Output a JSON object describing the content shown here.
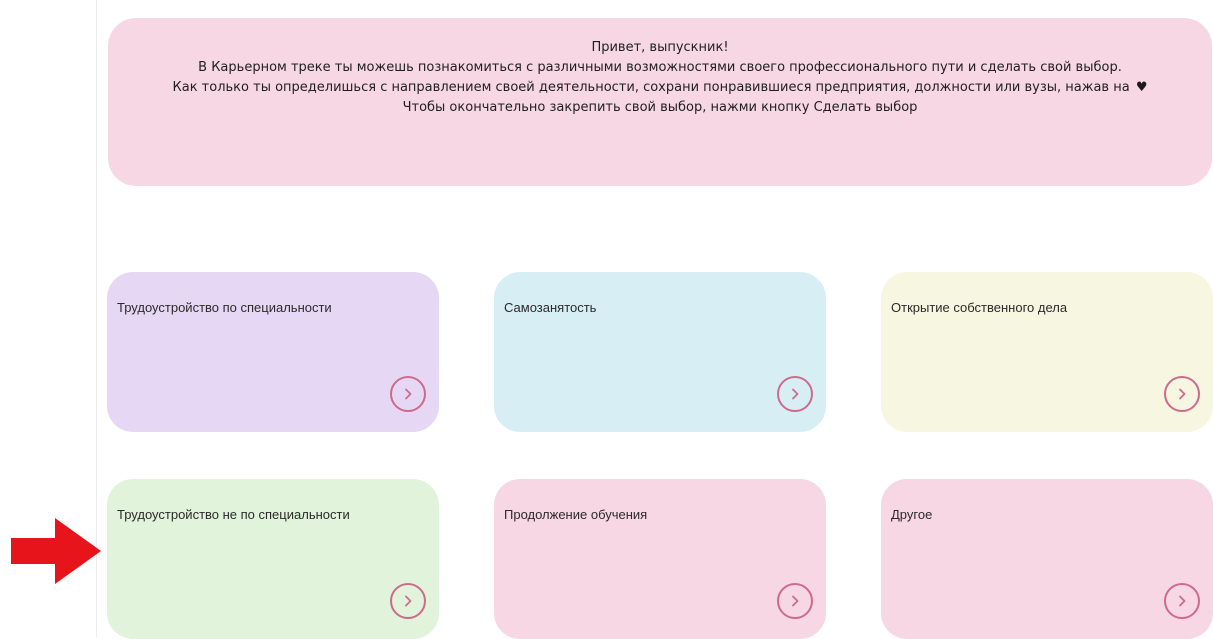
{
  "banner": {
    "lines": [
      "Привет, выпускник!",
      "В Карьерном треке ты можешь познакомиться с различными возможностями своего профессионального пути и сделать свой выбор.",
      "Как только ты определишься с направлением своей деятельности, сохрани понравившиеся предприятия, должности или вузы, нажав на",
      "Чтобы окончательно закрепить свой выбор, нажми кнопку Сделать выбор"
    ],
    "heart_icon": "heart-icon",
    "background": "#f6d7e3"
  },
  "cards": [
    {
      "title": "Трудоустройство по специальности",
      "background": "#e6d8f5",
      "icon": "chevron-right-circle-icon"
    },
    {
      "title": "Самозанятость",
      "background": "#d7eff4",
      "icon": "chevron-right-circle-icon"
    },
    {
      "title": "Открытие собственного дела",
      "background": "#f7f6e0",
      "icon": "chevron-right-circle-icon"
    },
    {
      "title": "Трудоустройство не по специальности",
      "background": "#e1f3db",
      "icon": "chevron-right-circle-icon"
    },
    {
      "title": "Продолжение обучения",
      "background": "#f6d7e3",
      "icon": "chevron-right-circle-icon"
    },
    {
      "title": "Другое",
      "background": "#f6d7e3",
      "icon": "chevron-right-circle-icon"
    }
  ],
  "accent_color": "#cf6a8c",
  "pointer_arrow_color": "#e8141b"
}
